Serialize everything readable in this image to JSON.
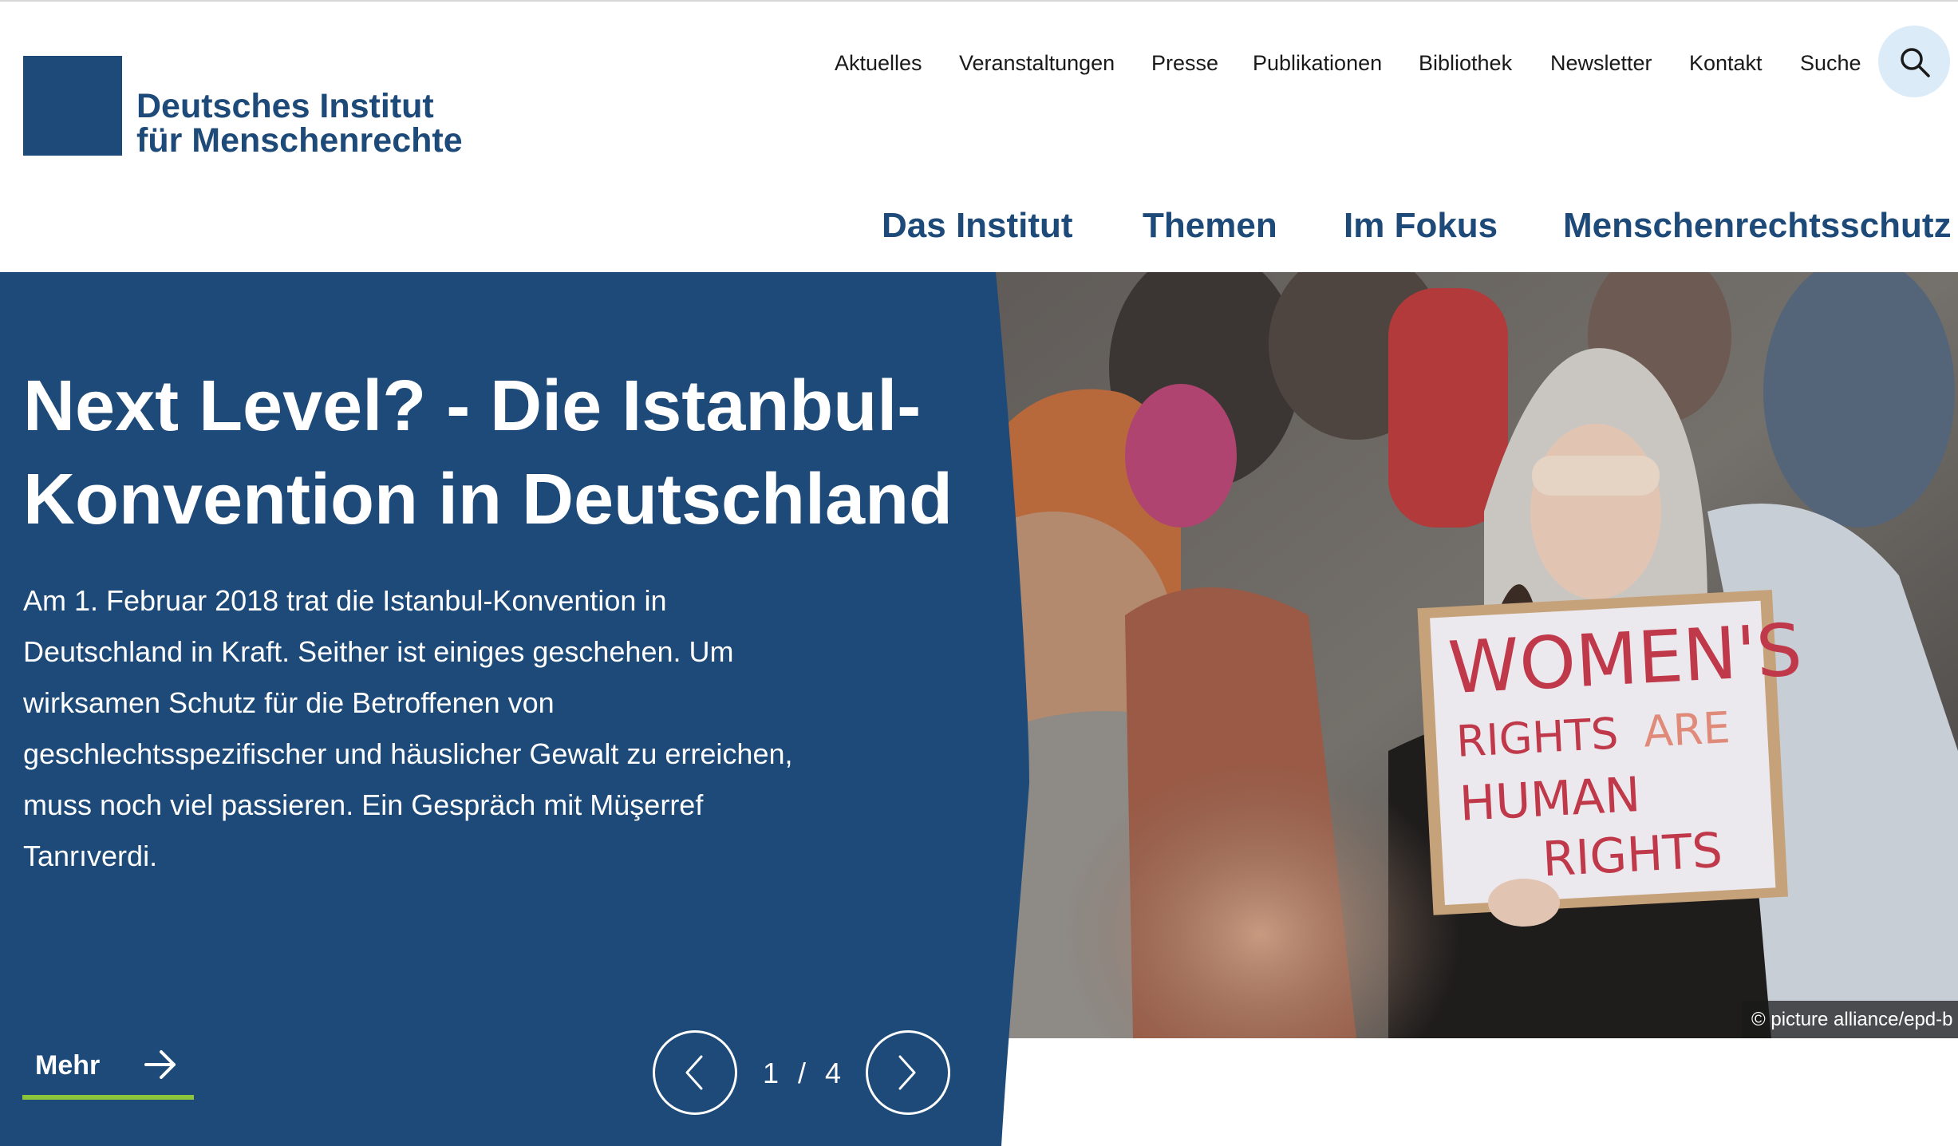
{
  "site": {
    "logo_line1": "Deutsches Institut",
    "logo_line2": "für Menschenrechte"
  },
  "top_nav": [
    "Aktuelles",
    "Veranstaltungen",
    "Presse",
    "Publikationen",
    "Bibliothek",
    "Newsletter",
    "Kontakt",
    "Suche"
  ],
  "search_icon": "search-icon",
  "main_nav": [
    "Das Institut",
    "Themen",
    "Im Fokus",
    "Menschenrechtsschutz"
  ],
  "hero": {
    "title_line1": "Next Level? - Die Istanbul-",
    "title_line2": "Konvention in Deutschland",
    "body_lines": [
      "Am 1. Februar 2018 trat die Istanbul-Konvention in",
      "Deutschland in Kraft. Seither ist einiges geschehen. Um",
      "wirksamen Schutz für die Betroffenen von",
      "geschlechtsspezifischer und häuslicher Gewalt zu erreichen,",
      "muss noch viel passieren. Ein Gespräch mit Müşerref",
      "Tanrıverdi."
    ],
    "more_label": "Mehr",
    "pager_current": "1",
    "pager_separator": "/",
    "pager_total": "4",
    "sign_lines": [
      "WOMEN'S",
      "RIGHTS",
      "ARE",
      "HUMAN",
      "RIGHTS"
    ],
    "photo_credit": "© picture alliance/epd-b"
  },
  "colors": {
    "brand_blue": "#1d4a78",
    "accent_green": "#8cc43c",
    "search_bg": "#dcebf8"
  }
}
